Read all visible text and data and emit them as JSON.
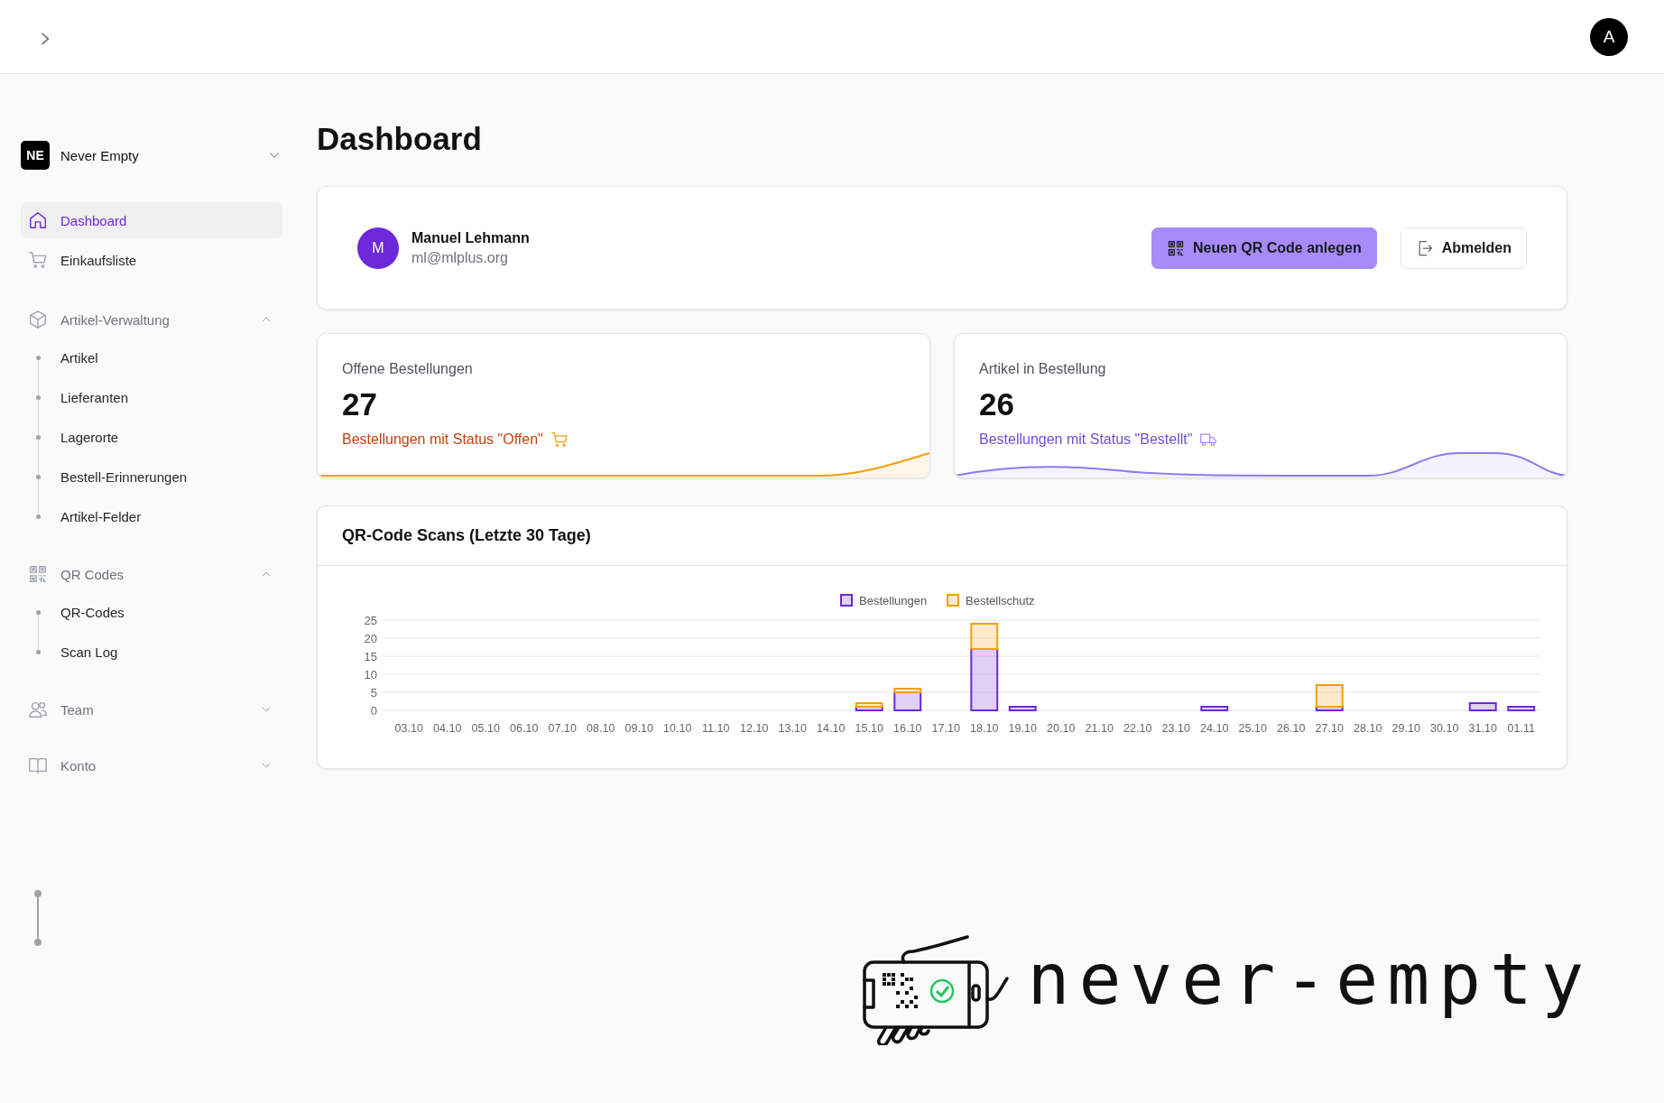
{
  "topbar": {
    "toggle": "›",
    "avatar": "A"
  },
  "sidebar": {
    "workspace": {
      "initials": "NE",
      "name": "Never Empty"
    },
    "nav": [
      {
        "kind": "link",
        "label": "Dashboard",
        "selected": true
      },
      {
        "kind": "link",
        "label": "Einkaufsliste",
        "selected": false
      },
      {
        "kind": "group",
        "label": "Artikel-Verwaltung",
        "expanded": true,
        "children": [
          {
            "label": "Artikel",
            "selected": false
          },
          {
            "label": "Lieferanten",
            "selected": false
          },
          {
            "label": "Lagerorte",
            "selected": false
          },
          {
            "label": "Bestell-Erinnerungen",
            "selected": false
          },
          {
            "label": "Artikel-Felder",
            "selected": false
          }
        ]
      },
      {
        "kind": "group",
        "label": "QR Codes",
        "expanded": true,
        "children": [
          {
            "label": "QR-Codes",
            "selected": false
          },
          {
            "label": "Scan Log",
            "selected": false
          }
        ]
      },
      {
        "kind": "group",
        "label": "Team",
        "expanded": false
      },
      {
        "kind": "group",
        "label": "Konto",
        "expanded": false
      }
    ]
  },
  "page_title": "Dashboard",
  "profile": {
    "initial": "M",
    "name": "Manuel Lehmann",
    "email": "ml@mlplus.org",
    "buttons": [
      {
        "kind": "primary",
        "label": "Neuen QR Code anlegen"
      },
      {
        "kind": "secondary",
        "label": "Abmelden"
      }
    ]
  },
  "stats": [
    {
      "label": "Offene Bestellungen",
      "value": "27",
      "link": "Bestellungen mit Status \"Offen\"",
      "color": "#c2410c"
    },
    {
      "label": "Artikel in Bestellung",
      "value": "26",
      "link": "Bestellungen mit Status \"Bestellt\"",
      "color": "#6d4fd0"
    }
  ],
  "scans": {
    "title": "QR-Code Scans (Letzte 30 Tage)",
    "chart_data": {
      "type": "bar",
      "stacked": true,
      "categories": [
        "03.10",
        "04.10",
        "05.10",
        "06.10",
        "07.10",
        "08.10",
        "09.10",
        "10.10",
        "11.10",
        "12.10",
        "13.10",
        "14.10",
        "15.10",
        "16.10",
        "17.10",
        "18.10",
        "19.10",
        "20.10",
        "21.10",
        "22.10",
        "23.10",
        "24.10",
        "25.10",
        "26.10",
        "27.10",
        "28.10",
        "29.10",
        "30.10",
        "31.10",
        "01.11"
      ],
      "series": [
        {
          "name": "Bestellungen",
          "color": "#6d28d9",
          "values": [
            0,
            0,
            0,
            0,
            0,
            0,
            0,
            0,
            0,
            0,
            0,
            0,
            1,
            5,
            0,
            17,
            1,
            0,
            0,
            0,
            0,
            1,
            0,
            0,
            1,
            0,
            0,
            0,
            2,
            1
          ]
        },
        {
          "name": "Bestellschutz",
          "color": "#f59e0b",
          "values": [
            0,
            0,
            0,
            0,
            0,
            0,
            0,
            0,
            0,
            0,
            0,
            0,
            1,
            1,
            0,
            7,
            0,
            0,
            0,
            0,
            0,
            0,
            0,
            0,
            6,
            0,
            0,
            0,
            0,
            0
          ]
        }
      ],
      "ylim": [
        0,
        25
      ],
      "yticks": [
        0,
        5,
        10,
        15,
        20,
        25
      ],
      "grid": true,
      "legend": true
    }
  },
  "logo": {
    "text": "never-empty"
  }
}
